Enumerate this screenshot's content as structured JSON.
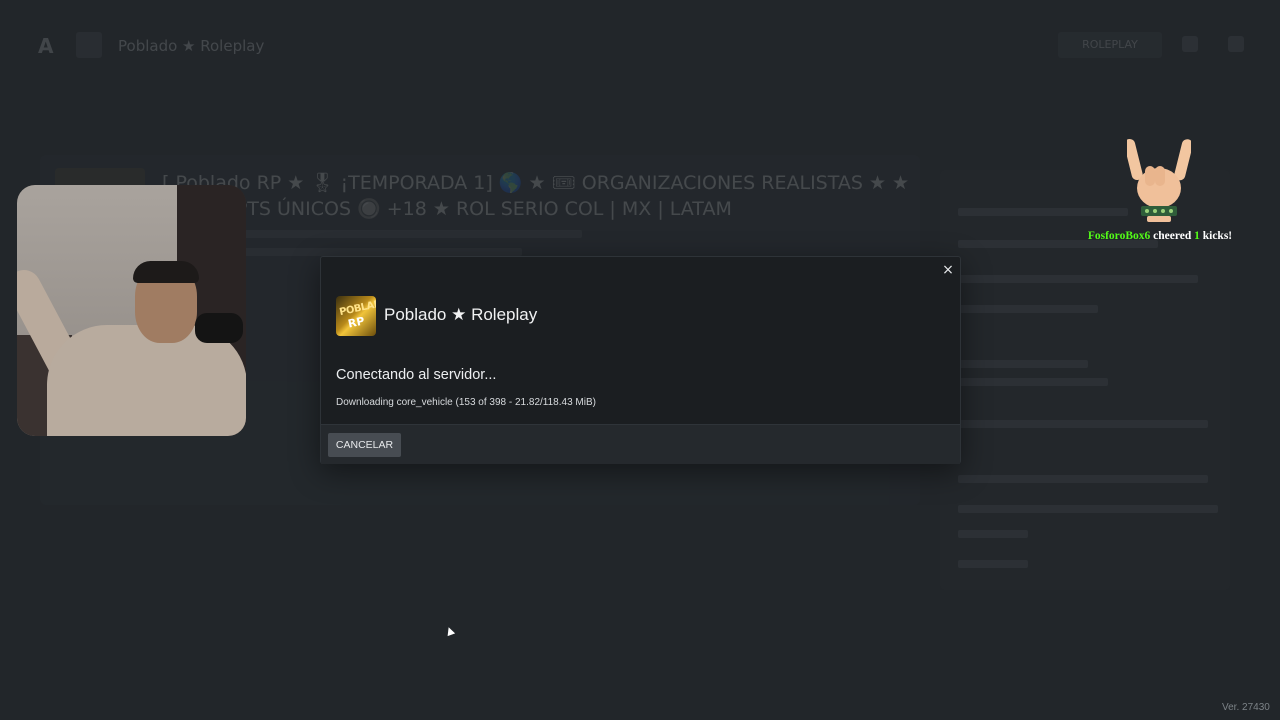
{
  "background": {
    "header_title": "Poblado ★ Roleplay",
    "header_button": "ROLEPLAY",
    "server_title": "[ Poblado RP ★ 🎖 ¡TEMPORADA 1] 🌎 ★ 🎟 ORGANIZACIONES REALISTAS ★ ★ 🎁 SCRIPTS ÚNICOS 🔘 +18 ★ ROL SERIO COL | MX | LATAM"
  },
  "modal": {
    "server_name": "Poblado ★ Roleplay",
    "server_icon_text_top": "POBLADO",
    "server_icon_text_bottom": "RP",
    "status": "Conectando al servidor...",
    "progress": "Downloading core_vehicle (153 of 398 - 21.82/118.43 MiB)",
    "close_label": "×",
    "cancel_label": "CANCELAR"
  },
  "alert": {
    "user": "FosforoBox6",
    "verb": "cheered",
    "count": "1",
    "unit": "kicks!"
  },
  "version": "Ver. 27430",
  "colors": {
    "accent_green": "#53fc18",
    "modal_bg": "#1b1e21",
    "page_bg": "#22262a"
  },
  "icons": {
    "close": "close-icon",
    "hand": "rock-hand-icon"
  }
}
